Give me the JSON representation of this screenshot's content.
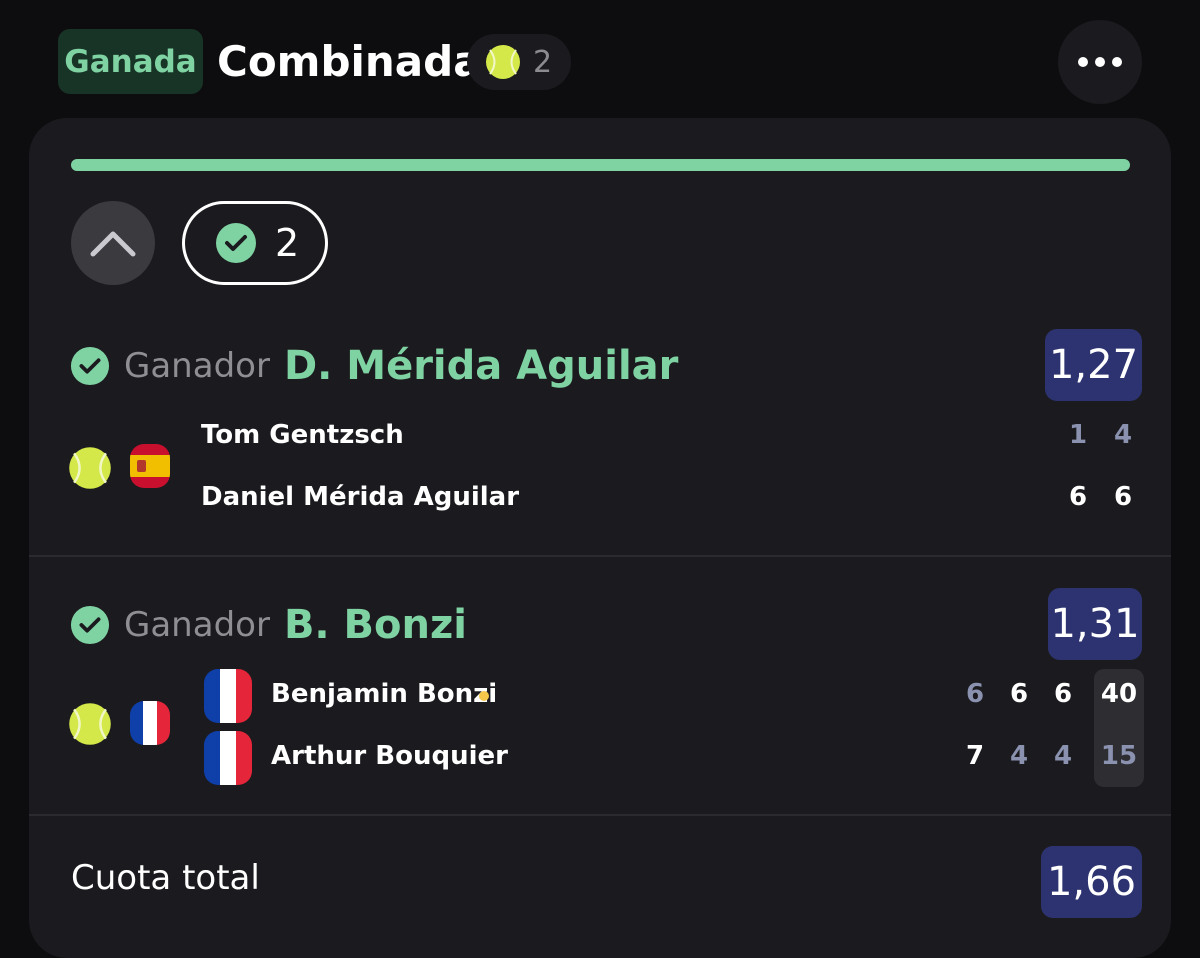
{
  "header": {
    "status_label": "Ganada",
    "title": "Combinada",
    "sport_icon": "tennis-ball-icon",
    "selection_count": "2",
    "more_icon": "more-horizontal-icon"
  },
  "card": {
    "progress_fraction": 1.0,
    "won_count": "2",
    "colors": {
      "won_green": "#7fd3a3",
      "odds_bg": "#2d3370",
      "card_bg": "#1b1b1f"
    }
  },
  "selections": [
    {
      "market": "Ganador",
      "pick": "D. Mérida Aguilar",
      "odds": "1,27",
      "players": [
        {
          "name": "Tom Gentzsch",
          "scores": [
            "1",
            "4"
          ]
        },
        {
          "name": "Daniel Mérida Aguilar",
          "scores": [
            "6",
            "6"
          ]
        }
      ]
    },
    {
      "market": "Ganador",
      "pick": "B. Bonzi",
      "odds": "1,31",
      "players": [
        {
          "name": "Benjamin Bonzi",
          "scores": [
            "6",
            "6",
            "6"
          ],
          "game_points": "40",
          "serving": true
        },
        {
          "name": "Arthur Bouquier",
          "scores": [
            "7",
            "4",
            "4"
          ],
          "game_points": "15"
        }
      ]
    }
  ],
  "total": {
    "label": "Cuota total",
    "odds": "1,66"
  }
}
